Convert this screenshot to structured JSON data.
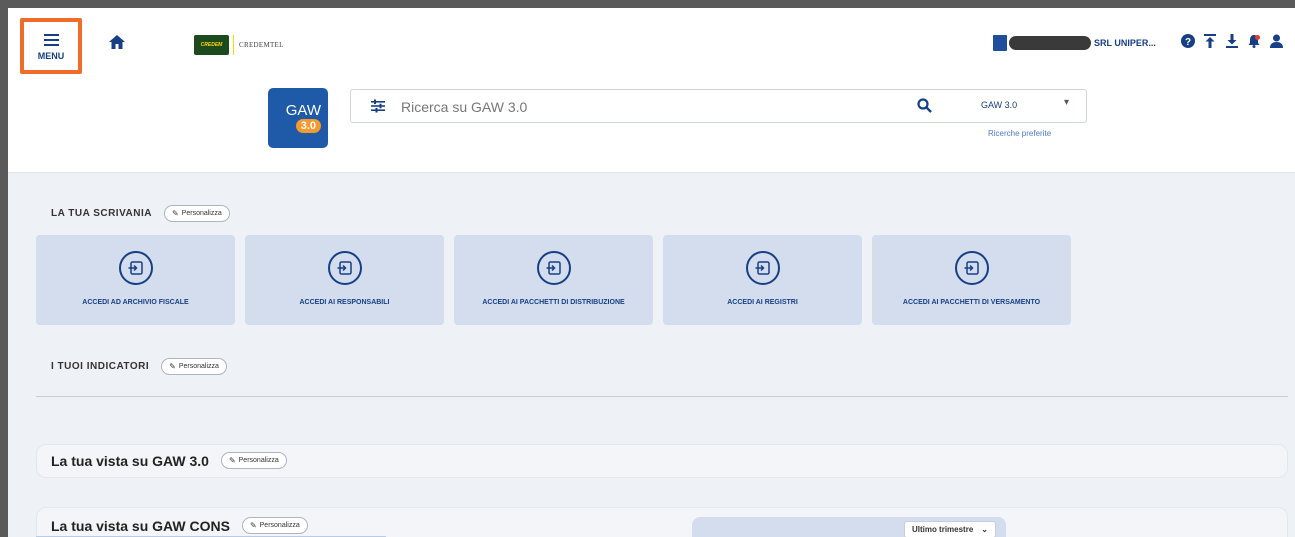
{
  "header": {
    "menu_label": "MENU",
    "brand_badge": "CREDEM",
    "brand_name": "CREDEMTEL",
    "user_name": "SRL UNIPER..."
  },
  "header_icons": [
    "help-icon",
    "upload-icon",
    "download-icon",
    "notifications-icon",
    "user-icon"
  ],
  "logo": {
    "line1": "GAW",
    "line2": "3.0"
  },
  "search": {
    "placeholder": "Ricerca su GAW 3.0",
    "scope": "GAW 3.0",
    "favorites_link": "Ricerche preferite"
  },
  "scrivania": {
    "title": "LA TUA SCRIVANIA",
    "customize": "Personalizza",
    "cards": [
      {
        "label": "ACCEDI AD ARCHIVIO FISCALE"
      },
      {
        "label": "ACCEDI AI RESPONSABILI"
      },
      {
        "label": "ACCEDI AI PACCHETTI DI DISTRIBUZIONE"
      },
      {
        "label": "ACCEDI AI REGISTRI"
      },
      {
        "label": "ACCEDI AI PACCHETTI DI VERSAMENTO"
      }
    ]
  },
  "indicatori": {
    "title": "I TUOI INDICATORI",
    "customize": "Personalizza"
  },
  "vista_gaw": {
    "title": "La tua vista su GAW 3.0",
    "customize": "Personalizza"
  },
  "vista_cons": {
    "title": "La tua vista su GAW CONS",
    "customize": "Personalizza",
    "period": "Ultimo trimestre"
  },
  "colors": {
    "brand": "#173f86",
    "accent": "#ef6c2a",
    "logo_blue": "#1e5aa8",
    "logo_orange": "#f29a2e",
    "card_bg": "#d3dded"
  }
}
